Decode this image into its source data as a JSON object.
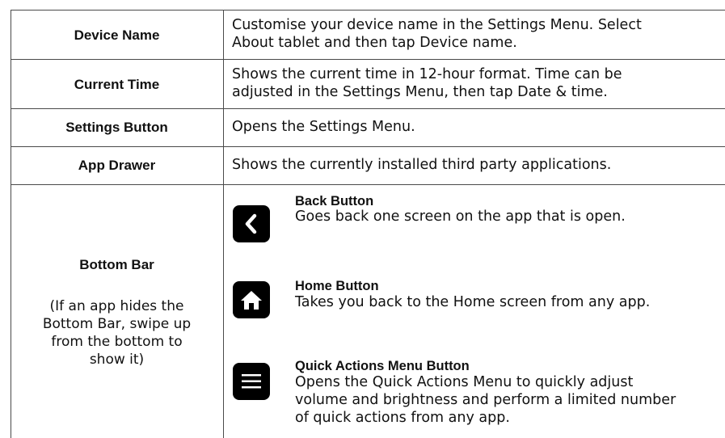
{
  "rows": [
    {
      "label": "Device Name",
      "desc1": "Customise your device name in the Settings Menu.  Select",
      "desc2": "About tablet and then tap Device name."
    },
    {
      "label": "Current Time",
      "desc1": "Shows the current time in 12-hour format. Time can be",
      "desc2": "adjusted in the Settings Menu, then tap Date & time."
    },
    {
      "label": "Settings Button",
      "desc1": "Opens the Settings Menu."
    },
    {
      "label": "App Drawer",
      "desc1": "Shows the currently installed third party applications."
    }
  ],
  "bottom_bar": {
    "label": "Bottom Bar",
    "note": [
      "(If an app hides the",
      "Bottom Bar, swipe up",
      "from the bottom to",
      "show it)"
    ],
    "buttons": [
      {
        "icon": "back-chevron-icon",
        "title": "Back Button",
        "desc": [
          "Goes back one screen on the app that is open."
        ]
      },
      {
        "icon": "home-icon",
        "title": "Home Button",
        "desc": [
          "Takes you back to the Home screen from any app."
        ]
      },
      {
        "icon": "menu-icon",
        "title": "Quick Actions Menu Button",
        "desc": [
          "Opens the Quick Actions Menu to quickly adjust",
          "volume and brightness and perform a limited number",
          "of quick actions from any app."
        ]
      }
    ]
  }
}
